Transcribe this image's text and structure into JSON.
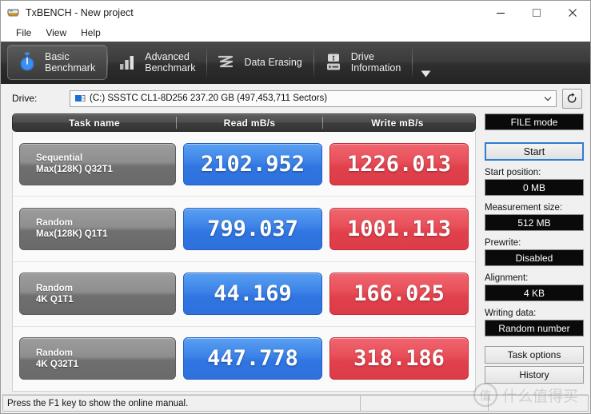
{
  "window": {
    "title": "TxBENCH - New project",
    "icon": "app-icon",
    "controls": {
      "minimize": "minimize-icon",
      "maximize": "maximize-icon",
      "close": "close-icon"
    }
  },
  "menu": {
    "items": [
      {
        "label": "File"
      },
      {
        "label": "View"
      },
      {
        "label": "Help"
      }
    ]
  },
  "toolbar": {
    "tabs": [
      {
        "label": "Basic\nBenchmark",
        "icon": "stopwatch-icon",
        "active": true
      },
      {
        "label": "Advanced\nBenchmark",
        "icon": "bar-chart-icon",
        "active": false
      },
      {
        "label": "Data Erasing",
        "icon": "eraser-wave-icon",
        "active": false
      },
      {
        "label": "Drive\nInformation",
        "icon": "hard-drive-info-icon",
        "active": false
      }
    ],
    "overflow_icon": "chevron-down-icon"
  },
  "drive": {
    "label": "Drive:",
    "selected": "(C:) SSSTC CL1-8D256  237.20 GB (497,453,711 Sectors)",
    "disk_icon": "disk-icon",
    "dropdown_icon": "chevron-down-icon",
    "refresh_icon": "refresh-icon"
  },
  "results": {
    "columns": [
      "Task name",
      "Read mB/s",
      "Write mB/s"
    ],
    "rows": [
      {
        "task": "Sequential\nMax(128K) Q32T1",
        "read": "2102.952",
        "write": "1226.013"
      },
      {
        "task": "Random\nMax(128K) Q1T1",
        "read": "799.037",
        "write": "1001.113"
      },
      {
        "task": "Random\n4K Q1T1",
        "read": "44.169",
        "write": "166.025"
      },
      {
        "task": "Random\n4K Q32T1",
        "read": "447.778",
        "write": "318.186"
      }
    ]
  },
  "panel": {
    "file_mode": "FILE mode",
    "start": "Start",
    "start_position_label": "Start position:",
    "start_position_value": "0 MB",
    "measurement_size_label": "Measurement size:",
    "measurement_size_value": "512 MB",
    "prewrite_label": "Prewrite:",
    "prewrite_value": "Disabled",
    "alignment_label": "Alignment:",
    "alignment_value": "4 KB",
    "writing_data_label": "Writing data:",
    "writing_data_value": "Random number",
    "task_options": "Task options",
    "history": "History"
  },
  "status": {
    "message": "Press the F1 key to show the online manual.",
    "pane2": "",
    "pane3": ""
  },
  "colors": {
    "read_chip": "#3e84e8",
    "write_chip": "#e8505a",
    "task_chip": "#8e8e8e",
    "accent_focus": "#2e7dd1",
    "toolbar_bg": "#3c3c3c"
  }
}
